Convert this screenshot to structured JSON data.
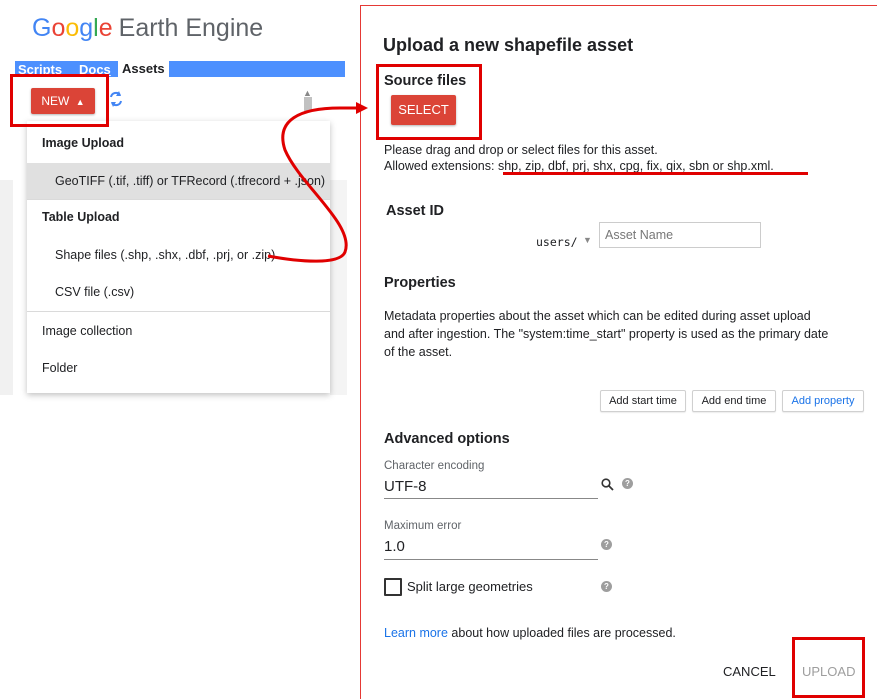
{
  "left_panel": {
    "logo": {
      "word1_letters": [
        "G",
        "o",
        "o",
        "g",
        "l",
        "e"
      ],
      "word2": "Earth Engine"
    },
    "tabs": [
      {
        "label": "Scripts"
      },
      {
        "label": "Docs"
      },
      {
        "label": "Assets",
        "active": true
      }
    ],
    "new_button": "NEW",
    "menu": {
      "image_upload_header": "Image Upload",
      "geotiff_item": "GeoTIFF (.tif, .tiff) or TFRecord (.tfrecord + .json)",
      "table_upload_header": "Table Upload",
      "shapefile_item": "Shape files (.shp, .shx, .dbf, .prj, or .zip)",
      "csv_item": "CSV file (.csv)",
      "image_collection_item": "Image collection",
      "folder_item": "Folder"
    }
  },
  "dialog": {
    "title": "Upload a new shapefile asset",
    "source_files_heading": "Source files",
    "select_button": "SELECT",
    "instructions_line1": "Please drag and drop or select files for this asset.",
    "instructions_label": "Allowed extensions:",
    "allowed_extensions": "shp, zip, dbf, prj, shx, cpg, fix, qix, sbn or shp.xml.",
    "asset_id_heading": "Asset ID",
    "asset_prefix": "users/",
    "asset_name_placeholder": "Asset Name",
    "properties_heading": "Properties",
    "properties_line1": "Metadata properties about the asset which can be edited during asset upload",
    "properties_line2": "and after ingestion. The \"system:time_start\" property is used as the primary date",
    "properties_line3": "of the asset.",
    "add_start_time": "Add start time",
    "add_end_time": "Add end time",
    "add_property": "Add property",
    "advanced_heading": "Advanced options",
    "char_encoding_label": "Character encoding",
    "char_encoding_value": "UTF-8",
    "max_error_label": "Maximum error",
    "max_error_value": "1.0",
    "split_label": "Split large geometries",
    "learn_more_link": "Learn more",
    "learn_more_rest": " about how uploaded files are processed.",
    "cancel_button": "CANCEL",
    "upload_button": "UPLOAD"
  },
  "colors": {
    "accent_red": "#db4437",
    "annotation_red": "#e00000",
    "tab_blue": "#4d90fe",
    "link_blue": "#1a73e8"
  },
  "icons": [
    "caret-up-icon",
    "refresh-icon",
    "search-icon",
    "help-icon",
    "dropdown-arrow-icon"
  ]
}
